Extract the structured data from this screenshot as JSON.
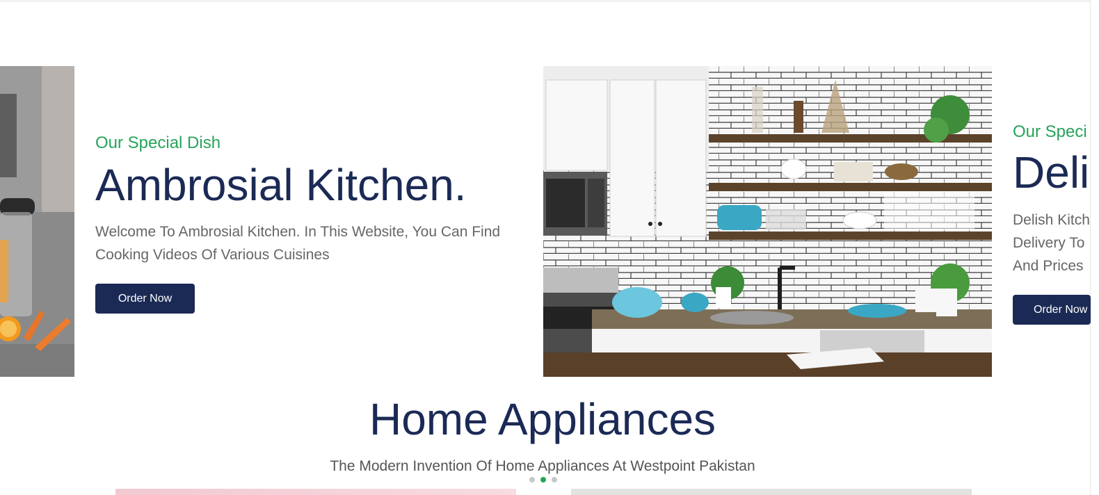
{
  "slides": [
    {
      "subtitle": "Our Special Dish",
      "title": "Ambrosial Kitchen.",
      "description": "Welcome To Ambrosial Kitchen. In This Website, You Can Find Cooking Videos Of Various Cuisines",
      "button_label": "Order Now"
    },
    {
      "subtitle": "Our Speci",
      "title": "Deli",
      "description_lines": [
        "Delish Kitch",
        "Delivery To",
        "And Prices"
      ],
      "button_label": "Order Now"
    }
  ],
  "section": {
    "title": "Home Appliances",
    "subtitle": "The Modern Invention Of Home Appliances At Westpoint Pakistan"
  },
  "carousel": {
    "dot_count": 3,
    "active_index": 1
  },
  "colors": {
    "brand_navy": "#1b2a55",
    "accent_green": "#27a35a",
    "text_gray": "#666666"
  }
}
